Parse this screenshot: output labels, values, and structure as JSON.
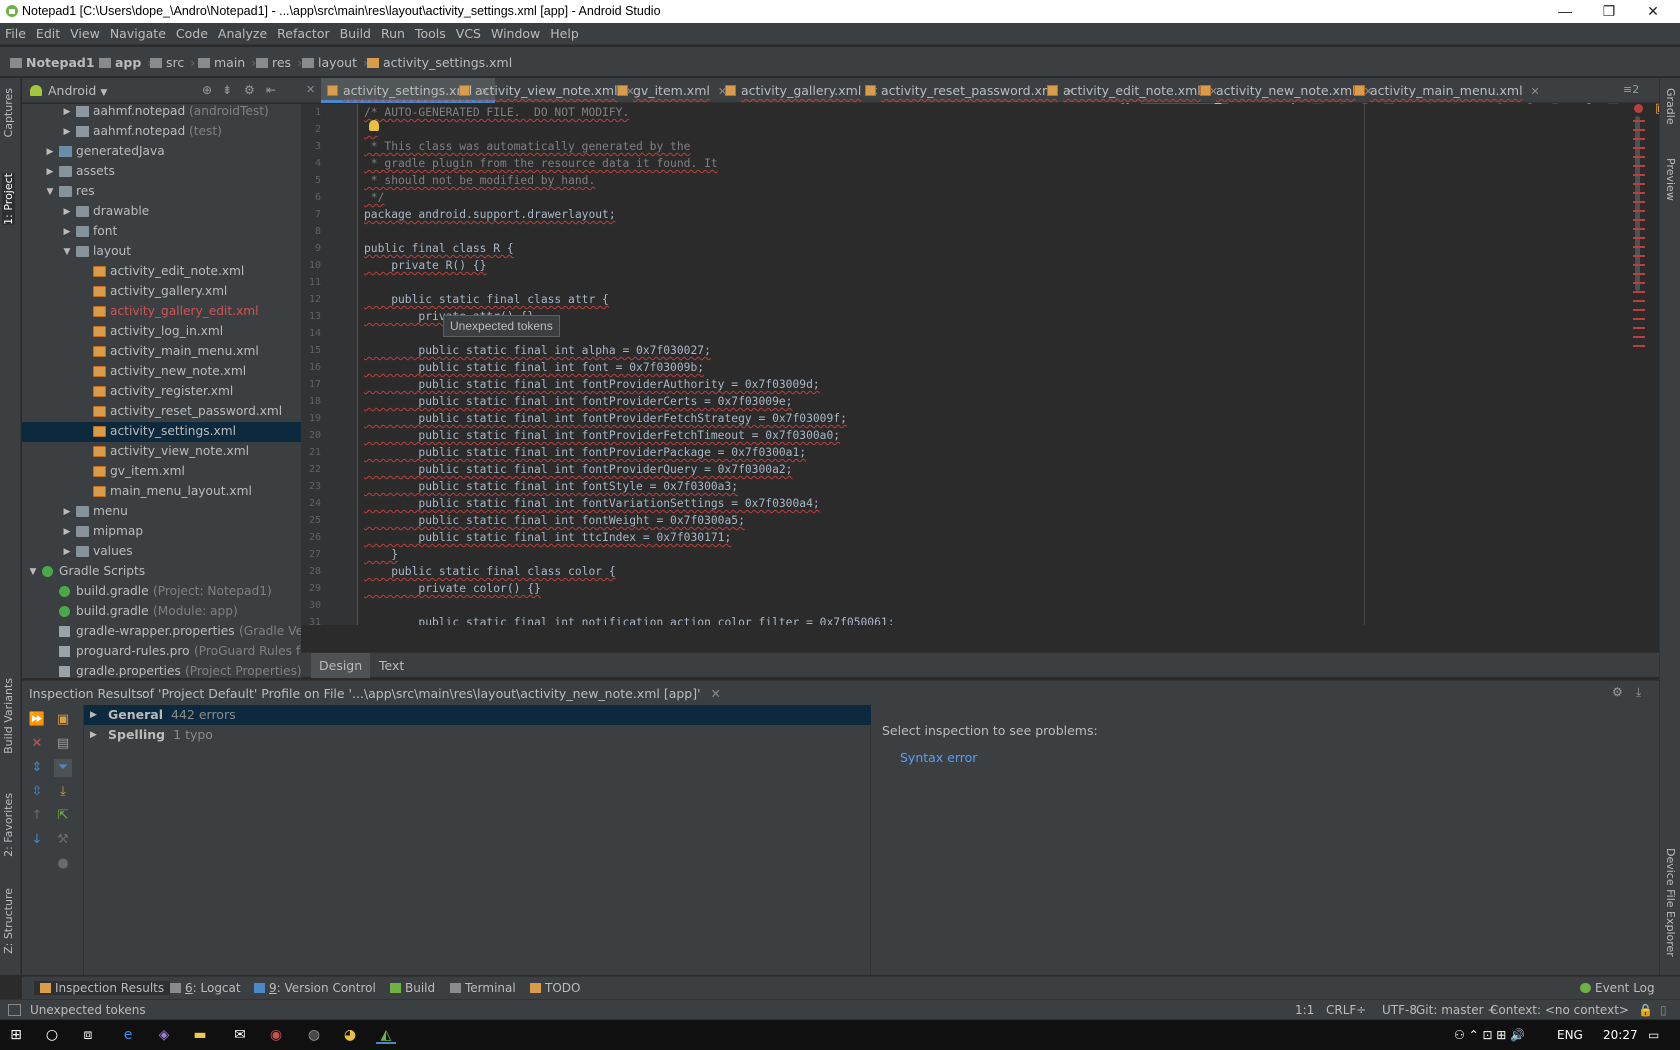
{
  "window": {
    "title": "Notepad1 [C:\\Users\\dope_\\Andro\\Notepad1] - ...\\app\\src\\main\\res\\layout\\activity_settings.xml [app] - Android Studio",
    "minimize": "—",
    "maximize": "❐",
    "close": "✕"
  },
  "menu": [
    "File",
    "Edit",
    "View",
    "Navigate",
    "Code",
    "Analyze",
    "Refactor",
    "Build",
    "Run",
    "Tools",
    "VCS",
    "Window",
    "Help"
  ],
  "breadcrumbs": [
    "Notepad1",
    "app",
    "src",
    "main",
    "res",
    "layout",
    "activity_settings.xml"
  ],
  "toolbar": {
    "run_config": "app"
  },
  "side_tabs_left": [
    "Captures",
    "1: Project",
    "Build Variants",
    "2: Favorites",
    "Z: Structure"
  ],
  "side_tabs_right": [
    "Gradle",
    "Preview",
    "Device File Explorer"
  ],
  "project": {
    "view_mode": "Android",
    "tree": [
      {
        "label": "aahmf.notepad",
        "suffix": "(androidTest)",
        "icon": "pkg",
        "level": 2,
        "arrow": "▶"
      },
      {
        "label": "aahmf.notepad",
        "suffix": "(test)",
        "icon": "pkg",
        "level": 2,
        "arrow": "▶"
      },
      {
        "label": "generatedJava",
        "suffix": "",
        "icon": "gen",
        "level": 1,
        "arrow": "▶"
      },
      {
        "label": "assets",
        "suffix": "",
        "icon": "folder",
        "level": 1,
        "arrow": "▶"
      },
      {
        "label": "res",
        "suffix": "",
        "icon": "folder",
        "level": 1,
        "arrow": "▼"
      },
      {
        "label": "drawable",
        "suffix": "",
        "icon": "folder",
        "level": 2,
        "arrow": "▶"
      },
      {
        "label": "font",
        "suffix": "",
        "icon": "folder",
        "level": 2,
        "arrow": "▶"
      },
      {
        "label": "layout",
        "suffix": "",
        "icon": "folder",
        "level": 2,
        "arrow": "▼"
      },
      {
        "label": "activity_edit_note.xml",
        "suffix": "",
        "icon": "xml",
        "level": 3,
        "arrow": ""
      },
      {
        "label": "activity_gallery.xml",
        "suffix": "",
        "icon": "xml",
        "level": 3,
        "arrow": ""
      },
      {
        "label": "activity_gallery_edit.xml",
        "suffix": "",
        "icon": "xml",
        "level": 3,
        "arrow": "",
        "red": true
      },
      {
        "label": "activity_log_in.xml",
        "suffix": "",
        "icon": "xml",
        "level": 3,
        "arrow": ""
      },
      {
        "label": "activity_main_menu.xml",
        "suffix": "",
        "icon": "xml",
        "level": 3,
        "arrow": ""
      },
      {
        "label": "activity_new_note.xml",
        "suffix": "",
        "icon": "xml",
        "level": 3,
        "arrow": ""
      },
      {
        "label": "activity_register.xml",
        "suffix": "",
        "icon": "xml",
        "level": 3,
        "arrow": ""
      },
      {
        "label": "activity_reset_password.xml",
        "suffix": "",
        "icon": "xml",
        "level": 3,
        "arrow": ""
      },
      {
        "label": "activity_settings.xml",
        "suffix": "",
        "icon": "xml",
        "level": 3,
        "arrow": "",
        "selected": true
      },
      {
        "label": "activity_view_note.xml",
        "suffix": "",
        "icon": "xml",
        "level": 3,
        "arrow": ""
      },
      {
        "label": "gv_item.xml",
        "suffix": "",
        "icon": "xml",
        "level": 3,
        "arrow": ""
      },
      {
        "label": "main_menu_layout.xml",
        "suffix": "",
        "icon": "xml",
        "level": 3,
        "arrow": ""
      },
      {
        "label": "menu",
        "suffix": "",
        "icon": "folder",
        "level": 2,
        "arrow": "▶"
      },
      {
        "label": "mipmap",
        "suffix": "",
        "icon": "folder",
        "level": 2,
        "arrow": "▶"
      },
      {
        "label": "values",
        "suffix": "",
        "icon": "folder",
        "level": 2,
        "arrow": "▶"
      },
      {
        "label": "Gradle Scripts",
        "suffix": "",
        "icon": "grad",
        "level": 0,
        "arrow": "▼"
      },
      {
        "label": "build.gradle",
        "suffix": "(Project: Notepad1)",
        "icon": "grad",
        "level": 1,
        "arrow": ""
      },
      {
        "label": "build.gradle",
        "suffix": "(Module: app)",
        "icon": "grad",
        "level": 1,
        "arrow": ""
      },
      {
        "label": "gradle-wrapper.properties",
        "suffix": "(Gradle Version",
        "icon": "file",
        "level": 1,
        "arrow": ""
      },
      {
        "label": "proguard-rules.pro",
        "suffix": "(ProGuard Rules for ap",
        "icon": "file",
        "level": 1,
        "arrow": ""
      },
      {
        "label": "gradle.properties",
        "suffix": "(Project Properties)",
        "icon": "file",
        "level": 1,
        "arrow": ""
      }
    ]
  },
  "editor_tabs": [
    {
      "label": "activity_settings.xml",
      "active": true
    },
    {
      "label": "activity_view_note.xml"
    },
    {
      "label": "gv_item.xml"
    },
    {
      "label": "activity_gallery.xml"
    },
    {
      "label": "activity_reset_password.xml"
    },
    {
      "label": "activity_edit_note.xml"
    },
    {
      "label": "activity_new_note.xml"
    },
    {
      "label": "activity_main_menu.xml"
    }
  ],
  "tab_overflow": "≡2",
  "code_lines": [
    "/* AUTO-GENERATED FILE.  DO NOT MODIFY.",
    " *",
    " * This class was automatically generated by the",
    " * gradle plugin from the resource data it found. It",
    " * should not be modified by hand.",
    " */",
    "package android.support.drawerlayout;",
    "",
    "public final class R {",
    "    private R() {}",
    "",
    "    public static final class attr {",
    "        private attr() {}",
    "",
    "        public static final int alpha = 0x7f030027;",
    "        public static final int font = 0x7f03009b;",
    "        public static final int fontProviderAuthority = 0x7f03009d;",
    "        public static final int fontProviderCerts = 0x7f03009e;",
    "        public static final int fontProviderFetchStrategy = 0x7f03009f;",
    "        public static final int fontProviderFetchTimeout = 0x7f0300a0;",
    "        public static final int fontProviderPackage = 0x7f0300a1;",
    "        public static final int fontProviderQuery = 0x7f0300a2;",
    "        public static final int fontStyle = 0x7f0300a3;",
    "        public static final int fontVariationSettings = 0x7f0300a4;",
    "        public static final int fontWeight = 0x7f0300a5;",
    "        public static final int ttcIndex = 0x7f030171;",
    "    }",
    "    public static final class color {",
    "        private color() {}",
    "",
    "        public static final int notification_action_color_filter = 0x7f050061;"
  ],
  "tooltip": "Unexpected tokens",
  "design_tabs": [
    "Design",
    "Text"
  ],
  "inspection": {
    "title": "Inspection Results:",
    "scope": "of 'Project Default' Profile on File '...\\app\\src\\main\\res\\layout\\activity_new_note.xml [app]'",
    "close": "✕",
    "groups": [
      {
        "name": "General",
        "count": "442 errors"
      },
      {
        "name": "Spelling",
        "count": "1 typo"
      }
    ],
    "placeholder": "Select inspection to see problems:",
    "link": "Syntax error"
  },
  "bottom_tabs": [
    {
      "prefix": "",
      "label": "Inspection Results"
    },
    {
      "prefix": "6",
      "label": ": Logcat"
    },
    {
      "prefix": "9",
      "label": ": Version Control"
    },
    {
      "prefix": "",
      "label": "Build"
    },
    {
      "prefix": "",
      "label": "Terminal"
    },
    {
      "prefix": "",
      "label": "TODO"
    }
  ],
  "event_log": "Event Log",
  "status": {
    "message": "Unexpected tokens",
    "position": "1:1",
    "line_sep": "CRLF÷",
    "encoding": "UTF-8",
    "vcs": "Git: master ÷",
    "context": "Context: <no context>"
  },
  "taskbar": {
    "lang": "ENG",
    "time": "20:27"
  },
  "colors": {
    "accent": "#4a88c7",
    "error": "#bc3f3c",
    "android": "#a4c639",
    "link": "#589df6"
  }
}
